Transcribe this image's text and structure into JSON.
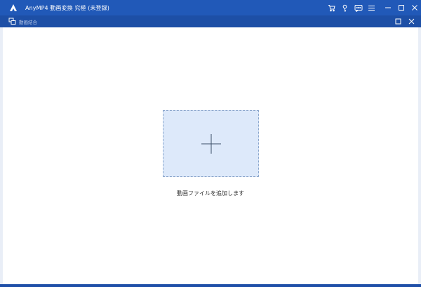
{
  "window": {
    "title": "AnyMP4 動画変換 究極 (未登録)",
    "controls": [
      "cart-icon",
      "key-icon",
      "feedback-icon",
      "menu-icon",
      "minimize-icon",
      "maximize-icon",
      "close-icon"
    ]
  },
  "subwindow": {
    "title": "動画結合",
    "controls": [
      "maximize-icon",
      "close-icon"
    ]
  },
  "main": {
    "add_hint": "動画ファイルを追加します"
  },
  "colors": {
    "titlebar": "#2159b8",
    "drop_zone_fill": "#dde9fa",
    "drop_zone_border": "#8aa6cc"
  }
}
